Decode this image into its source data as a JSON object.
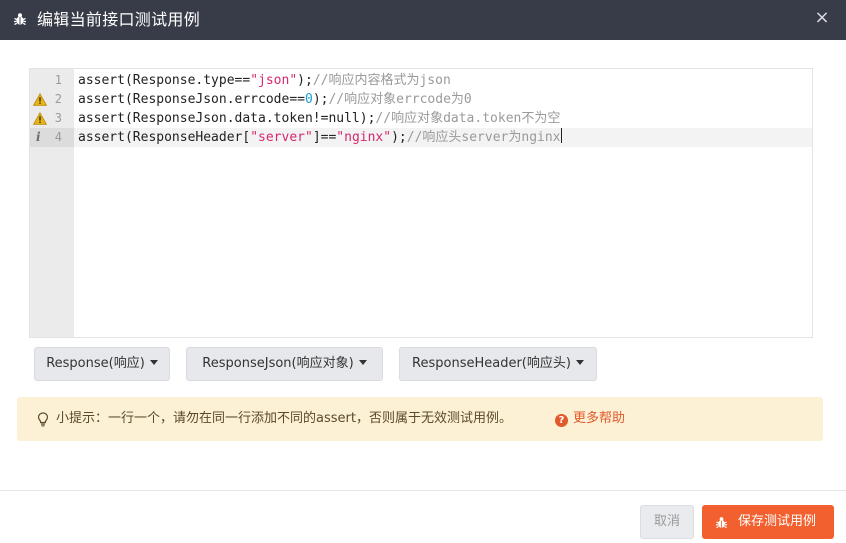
{
  "dialog": {
    "title": "编辑当前接口测试用例",
    "close_symbol": "×",
    "title_icon": "bug-icon"
  },
  "editor": {
    "lines": [
      {
        "number": "1",
        "marker": "",
        "code": "assert(Response.type==",
        "str": "\"json\"",
        "tail": ");",
        "comment": "//响应内容格式为json"
      },
      {
        "number": "2",
        "marker": "warning",
        "code": "assert(ResponseJson.errcode==",
        "num": "0",
        "tail": ");",
        "comment": "//响应对象errcode为0"
      },
      {
        "number": "3",
        "marker": "warning",
        "code": "assert(ResponseJson.data.token!=null);",
        "comment": "//响应对象data.token不为空"
      },
      {
        "number": "4",
        "marker": "info",
        "code": "assert(ResponseHeader[",
        "str": "\"server\"",
        "code2": "]==",
        "str2": "\"nginx\"",
        "tail": ");",
        "comment": "//响应头server为nginx"
      }
    ]
  },
  "dropdowns": [
    {
      "label": "Response(响应)"
    },
    {
      "label": "ResponseJson(响应对象)"
    },
    {
      "label": "ResponseHeader(响应头)"
    }
  ],
  "tip": {
    "icon": "lightbulb-icon",
    "text": "小提示：一行一个，请勿在同一行添加不同的assert，否则属于无效测试用例。",
    "help_icon": "question-circle-icon",
    "help_label": "更多帮助"
  },
  "footer": {
    "cancel_label": "取消",
    "save_label": "保存测试用例",
    "save_icon": "bug-icon"
  },
  "colors": {
    "titlebar": "#383c48",
    "accent": "#f2602f",
    "string": "#d6286f",
    "number": "#1a9fd6",
    "comment": "#9a9a9a",
    "tip_background": "#fcf0d5"
  }
}
